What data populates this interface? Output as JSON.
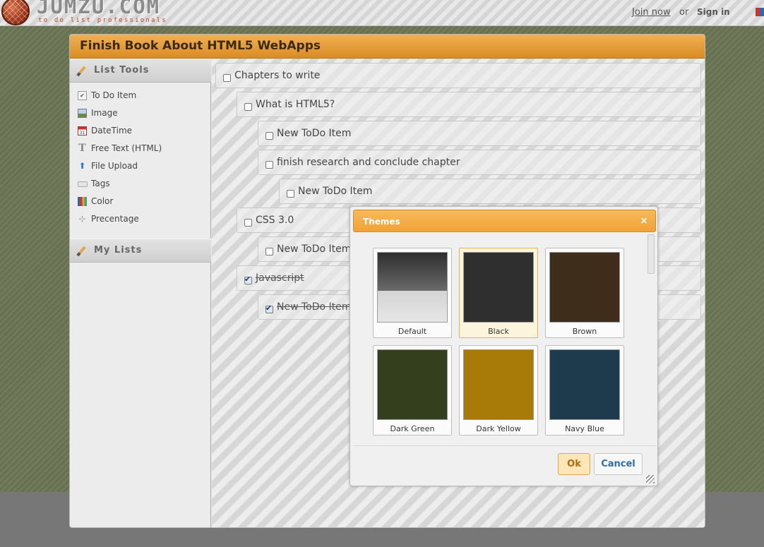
{
  "site": {
    "logo_text": "JUMZU.COM",
    "tagline": "to do list professionals",
    "join_label": "Join now",
    "or_label": "or",
    "signin_label": "Sign in"
  },
  "panel": {
    "title": "Finish Book About HTML5 WebApps"
  },
  "sidebar": {
    "tools_heading": "List Tools",
    "tools": [
      {
        "label": "To Do Item",
        "icon": "checkbox-icon"
      },
      {
        "label": "Image",
        "icon": "image-icon"
      },
      {
        "label": "DateTime",
        "icon": "calendar-icon"
      },
      {
        "label": "Free Text (HTML)",
        "icon": "text-icon"
      },
      {
        "label": "File Upload",
        "icon": "upload-icon"
      },
      {
        "label": "Tags",
        "icon": "tag-icon"
      },
      {
        "label": "Color",
        "icon": "color-icon"
      },
      {
        "label": "Precentage",
        "icon": "percentage-icon"
      }
    ],
    "lists_heading": "My Lists"
  },
  "todos": [
    {
      "label": "Chapters to write",
      "checked": false
    },
    {
      "label": "What is HTML5?",
      "checked": false
    },
    {
      "label": "New ToDo Item",
      "checked": false
    },
    {
      "label": "finish research and conclude chapter",
      "checked": false
    },
    {
      "label": "New ToDo Item",
      "checked": false
    },
    {
      "label": "CSS 3.0",
      "checked": false
    },
    {
      "label": "New ToDo Item",
      "checked": false
    },
    {
      "label": "Javascript",
      "checked": true
    },
    {
      "label": "New ToDo Item",
      "checked": true
    }
  ],
  "dialog": {
    "title": "Themes",
    "close_symbol": "×",
    "themes": [
      {
        "label": "Default",
        "color": "#555555",
        "selected": false
      },
      {
        "label": "Black",
        "color": "#2f2f2f",
        "selected": true
      },
      {
        "label": "Brown",
        "color": "#3f2d1c",
        "selected": false
      },
      {
        "label": "Dark Green",
        "color": "#34401d",
        "selected": false
      },
      {
        "label": "Dark Yellow",
        "color": "#a87a07",
        "selected": false
      },
      {
        "label": "Navy Blue",
        "color": "#1e3a4d",
        "selected": false
      }
    ],
    "ok_label": "Ok",
    "cancel_label": "Cancel"
  },
  "colors": {
    "accent_orange": "#f0a336",
    "ok_text": "#b36a08",
    "cancel_text": "#2a6fad"
  }
}
